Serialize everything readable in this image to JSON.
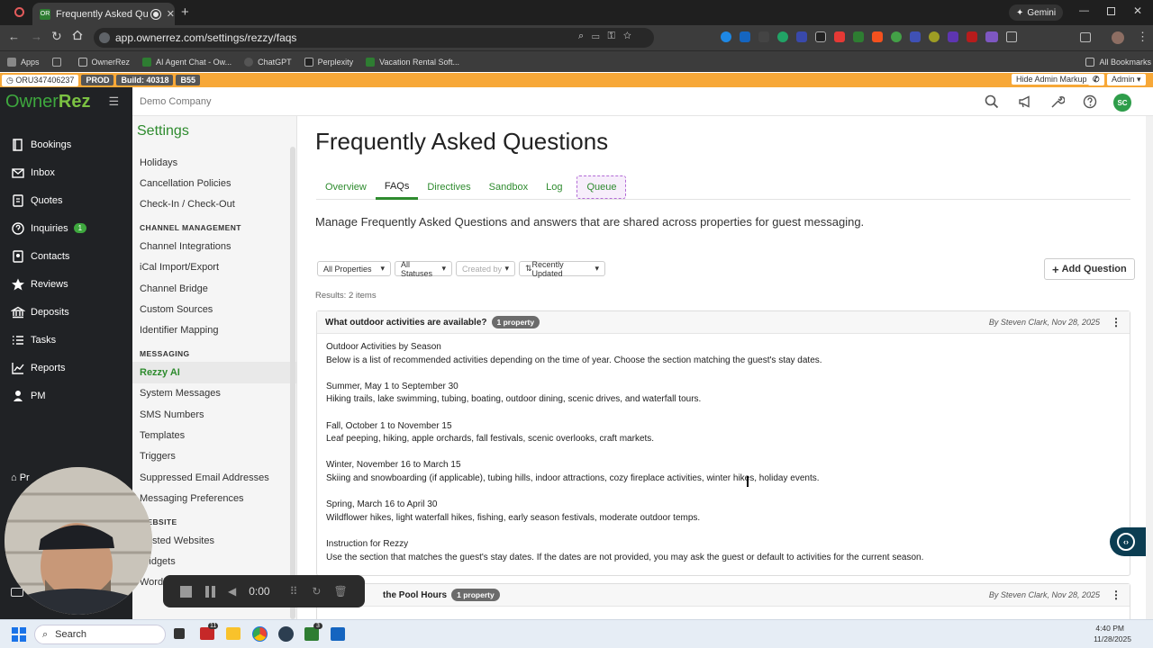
{
  "browser": {
    "tab_title": "Frequently Asked Question",
    "tab_favicon": "OR",
    "url": "app.ownerrez.com/settings/rezzy/faqs",
    "gemini_label": "Gemini",
    "bookmarks": [
      "Apps",
      "OwnerRez",
      "AI Agent Chat - Ow...",
      "ChatGPT",
      "Perplexity",
      "Vacation Rental Soft..."
    ],
    "all_bookmarks": "All Bookmarks"
  },
  "adminbar": {
    "id": "ORU347406237",
    "env": "PROD",
    "build": "Build: 40318",
    "server": "B55",
    "hide_markup": "Hide Admin Markup",
    "admin": "Admin"
  },
  "brand": {
    "owner": "Owner",
    "rez": "Rez"
  },
  "sidebar": {
    "items": [
      {
        "label": "Bookings",
        "icon": "book-icon"
      },
      {
        "label": "Inbox",
        "icon": "envelope-icon"
      },
      {
        "label": "Quotes",
        "icon": "quote-icon"
      },
      {
        "label": "Inquiries",
        "icon": "inquiry-icon",
        "badge": "1"
      },
      {
        "label": "Contacts",
        "icon": "contacts-icon"
      },
      {
        "label": "Reviews",
        "icon": "star-icon"
      },
      {
        "label": "Deposits",
        "icon": "bank-icon"
      },
      {
        "label": "Tasks",
        "icon": "list-icon"
      },
      {
        "label": "Reports",
        "icon": "chart-icon"
      },
      {
        "label": "PM",
        "icon": "user-icon"
      }
    ],
    "partial_label": "Pr"
  },
  "header": {
    "company": "Demo Company",
    "avatar": "SC"
  },
  "settings": {
    "title": "Settings",
    "group1": [
      "Holidays",
      "Cancellation Policies",
      "Check-In / Check-Out"
    ],
    "channel_header": "CHANNEL MANAGEMENT",
    "channel_items": [
      "Channel Integrations",
      "iCal Import/Export",
      "Channel Bridge",
      "Custom Sources",
      "Identifier Mapping"
    ],
    "messaging_header": "MESSAGING",
    "messaging_items": [
      "Rezzy AI",
      "System Messages",
      "SMS Numbers",
      "Templates",
      "Triggers",
      "Suppressed Email Addresses",
      "Messaging Preferences"
    ],
    "website_header": "WEBSITE",
    "website_items": [
      "Hosted Websites",
      "Widgets",
      "WordPress"
    ]
  },
  "page": {
    "title": "Frequently Asked Questions",
    "tabs": [
      "Overview",
      "FAQs",
      "Directives",
      "Sandbox",
      "Log",
      "Queue"
    ],
    "active_tab": "FAQs",
    "description": "Manage Frequently Asked Questions and answers that are shared across properties for guest messaging.",
    "filters": {
      "properties": "All Properties",
      "statuses": "All Statuses",
      "created_by": "Created by",
      "sort": "Recently Updated"
    },
    "add_button": "Add Question",
    "results": "Results: 2 items",
    "faqs": [
      {
        "question": "What outdoor activities are available?",
        "badge": "1 property",
        "meta": "By Steven Clark, Nov 28, 2025",
        "lines": [
          "Outdoor Activities by Season",
          "Below is a list of recommended activities depending on the time of year. Choose the section matching the guest's stay dates.",
          "",
          "Summer, May 1 to September 30",
          "Hiking trails, lake swimming, tubing, boating, outdoor dining, scenic drives, and waterfall tours.",
          "",
          "Fall, October 1 to November 15",
          "Leaf peeping, hiking, apple orchards, fall festivals, scenic overlooks, craft markets.",
          "",
          "Winter, November 16 to March 15",
          "Skiing and snowboarding (if applicable), tubing hills, indoor attractions, cozy fireplace activities, winter hikes, holiday events.",
          "",
          "Spring, March 16 to April 30",
          "Wildflower hikes, light waterfall hikes, fishing, early season festivals, moderate outdoor temps.",
          "",
          "Instruction for Rezzy",
          "Use the section that matches the guest's stay dates. If the dates are not provided, you may ask the guest or default to activities for the current season."
        ]
      },
      {
        "question": "the Pool Hours",
        "badge": "1 property",
        "meta": "By Steven Clark, Nov 28, 2025"
      }
    ]
  },
  "recorder": {
    "time": "0:00"
  },
  "taskbar": {
    "search": "Search",
    "time": "4:40 PM",
    "date": "11/28/2025",
    "mail_badge": "11",
    "teams_badge": "3"
  },
  "colors": {
    "brand_green": "#2e8b2e",
    "admin_orange": "#f7a838",
    "sidebar_bg": "#202225"
  }
}
